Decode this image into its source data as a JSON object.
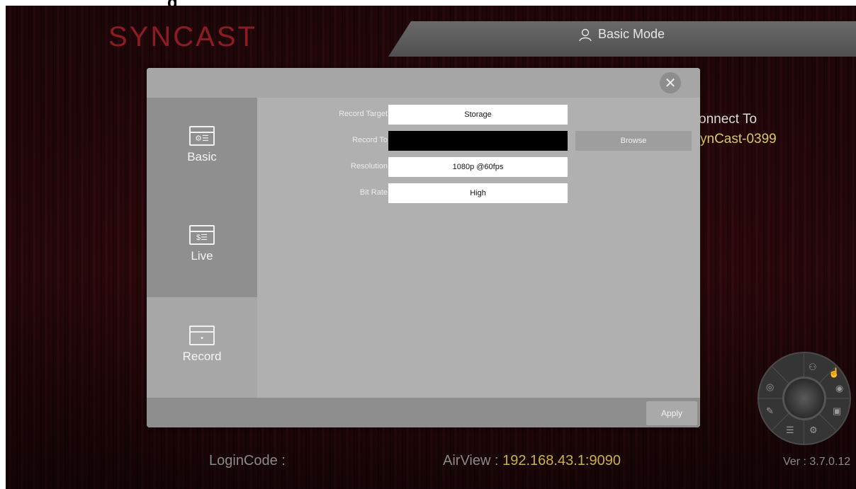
{
  "crop_text": "g",
  "app": {
    "logo": "SYNCAST",
    "mode_label": "Basic Mode",
    "connect_label": "onnect To",
    "device_name": "ynCast-0399"
  },
  "footer": {
    "login_label": "LoginCode :",
    "airview_label": "AirView : ",
    "airview_address": "192.168.43.1:9090",
    "version": "Ver : 3.7.0.12"
  },
  "dialog": {
    "tabs": [
      {
        "label": "Basic",
        "icon": "basic-settings-icon",
        "glyph": "⚙☰"
      },
      {
        "label": "Live",
        "icon": "live-settings-icon",
        "glyph": "$☰"
      },
      {
        "label": "Record",
        "icon": "record-settings-icon",
        "glyph": "•"
      }
    ],
    "active_tab": "Record",
    "fields": {
      "record_target": {
        "label": "Record Target",
        "value": "Storage"
      },
      "record_to": {
        "label": "Record To",
        "value": ""
      },
      "resolution": {
        "label": "Resolution",
        "value": "1080p @60fps"
      },
      "bit_rate": {
        "label": "Bit Rate",
        "value": "High"
      }
    },
    "browse_label": "Browse",
    "apply_label": "Apply",
    "close_glyph": "✕"
  },
  "wheel_icons": [
    "user-edit-icon",
    "hand-icon",
    "camera-icon",
    "screen-play-icon",
    "gear-icon",
    "list-icon",
    "pen-icon",
    "eye-icon"
  ],
  "colors": {
    "logo": "#8c1c24",
    "accent_yellow": "#c9b24a",
    "dialog_bg": "#a7a7a7",
    "sidebar_bg": "#8f8f8f"
  }
}
